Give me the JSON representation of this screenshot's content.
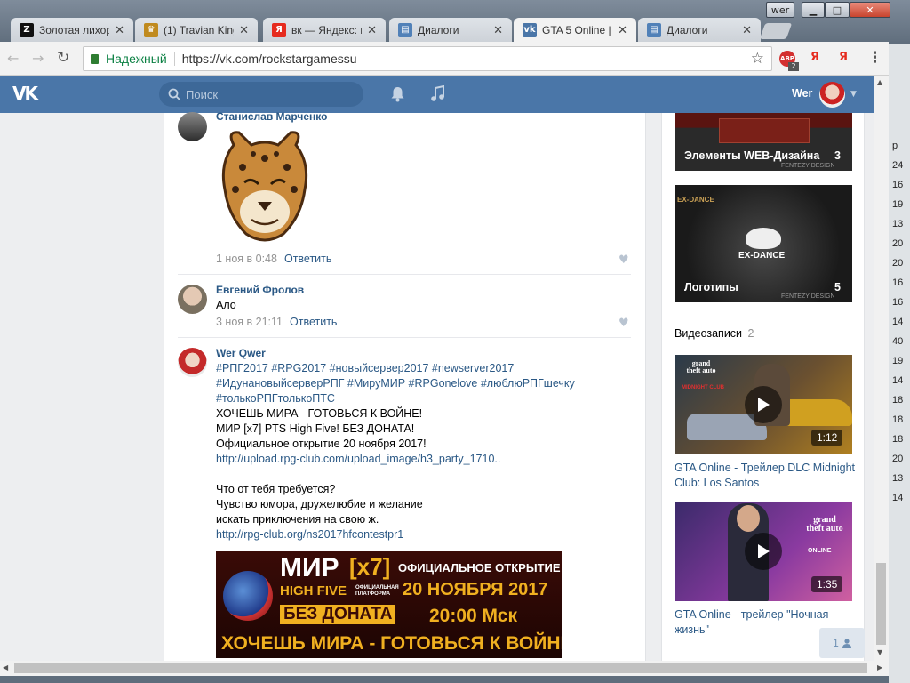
{
  "window": {
    "user_badge": "wer",
    "minimize": "▁",
    "maximize": "□",
    "close": "✕"
  },
  "tabs": [
    {
      "label": "Золотая лихор",
      "favicon": "Z",
      "favicon_color": "#111111"
    },
    {
      "label": "(1) Travian King",
      "favicon": "♛",
      "favicon_color": "#c08a1e"
    },
    {
      "label": "вк — Яндекс: н",
      "favicon": "Я",
      "favicon_color": "#e62b1e"
    },
    {
      "label": "Диалоги",
      "favicon": "▤",
      "favicon_color": "#5181b8"
    },
    {
      "label": "GTA 5 Online |",
      "favicon": "vk",
      "favicon_color": "#4a76a8"
    },
    {
      "label": "Диалоги",
      "favicon": "▤",
      "favicon_color": "#5181b8"
    }
  ],
  "toolbar": {
    "secure_label": "Надежный",
    "url": "https://vk.com/rockstargamessu",
    "abp": "ABP",
    "abp_count": "2",
    "ya1": "Я",
    "ya2": "Я",
    "star": "☆",
    "menu": "⋮"
  },
  "vk": {
    "logo": "VK",
    "search_placeholder": "Поиск",
    "username": "Wer",
    "accent": "#4a76a8"
  },
  "posts": [
    {
      "author": "Станислав Марченко",
      "meta": "1 ноя в 0:48",
      "reply": "Ответить"
    },
    {
      "author": "Евгений Фролов",
      "text": "Ало",
      "meta": "3 ноя в 21:11",
      "reply": "Ответить"
    },
    {
      "author": "Wer Qwer",
      "lines": [
        {
          "t": "#РПГ2017 #RPG2017 #новыйсервер2017 #newserver2017",
          "link": true
        },
        {
          "t": "#ИдунановыйсерверРПГ #МируМИР #RPGonelove #люблюРПГшечку",
          "link": true
        },
        {
          "t": "#толькоРПГтолькоПТС",
          "link": true
        },
        {
          "t": "ХОЧЕШЬ МИРА - ГОТОВЬСЯ К ВОЙНЕ!",
          "link": false
        },
        {
          "t": "МИР [x7] PTS High Five! БЕЗ ДОНАТА!",
          "link": false
        },
        {
          "t": "Официальное открытие 20 ноября 2017!",
          "link": false
        },
        {
          "t": "http://upload.rpg-club.com/upload_image/h3_party_1710..",
          "link": true
        },
        {
          "t": "",
          "link": false
        },
        {
          "t": "Что от тебя требуется?",
          "link": false
        },
        {
          "t": "Чувство юмора, дружелюбие и желание",
          "link": false
        },
        {
          "t": "искать приключения на свою ж.",
          "link": false
        },
        {
          "t": "http://rpg-club.org/ns2017hfcontestpr1",
          "link": true
        }
      ],
      "banner": {
        "mir": "МИР",
        "x7": "[x7]",
        "official": "ОФИЦИАЛЬНОЕ ОТКРЫТИЕ",
        "highfive": "HIGH FIVE",
        "platform": "ОФИЦИАЛЬНАЯ ПЛАТФОРМА",
        "date": "20 НОЯБРЯ 2017",
        "nodonate": "БЕЗ ДОНАТА",
        "time": "20:00 Мск",
        "slogan": "ХОЧЕШЬ МИРА - ГОТОВЬСЯ К ВОЙНЕ"
      }
    }
  ],
  "albums": [
    {
      "label": "Элементы WEB-Дизайна",
      "count": "3",
      "brand": "FENTEZY DESIGN"
    },
    {
      "label": "Логотипы",
      "count": "5",
      "brand": "FENTEZY DESIGN",
      "logo_text": "EX-DANCE"
    }
  ],
  "videos_section": {
    "title": "Видеозаписи",
    "count": "2"
  },
  "videos": [
    {
      "title": "GTA Online - Трейлер DLC Midnight Club: Los Santos",
      "duration": "1:12",
      "overlay": "grand theft auto",
      "sub": "MIDNIGHT CLUB"
    },
    {
      "title": "GTA Online - трейлер \"Ночная жизнь\"",
      "duration": "1:35",
      "overlay": "grand theft auto",
      "sub": "ONLINE"
    }
  ],
  "friends_badge": "1",
  "right_strip_numbers": [
    "р",
    "24",
    "16",
    "19",
    "13",
    "20",
    "20",
    "16",
    "16",
    "14",
    "40",
    "19",
    "14",
    "18",
    "18",
    "18",
    "20",
    "13",
    "14"
  ]
}
